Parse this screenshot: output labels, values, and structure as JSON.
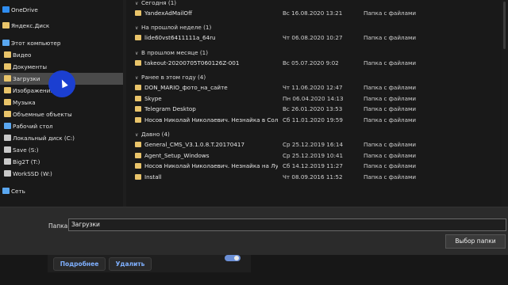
{
  "colors": {
    "folder_yellow": "#e9c46a",
    "onedrive_blue": "#2f8df0",
    "pc_blue": "#5aa7f0",
    "drive_gray": "#c9c9c9",
    "selected_bg": "#4a4a4a"
  },
  "sidebar": {
    "items": [
      {
        "label": "OneDrive",
        "icon": "onedrive-icon"
      },
      {
        "label": "Яндекс.Диск",
        "icon": "folder-icon"
      },
      {
        "label": "Этот компьютер",
        "icon": "computer-icon"
      },
      {
        "label": "Видео",
        "icon": "video-folder-icon"
      },
      {
        "label": "Документы",
        "icon": "documents-folder-icon"
      },
      {
        "label": "Загрузки",
        "icon": "downloads-folder-icon",
        "selected": true
      },
      {
        "label": "Изображения",
        "icon": "pictures-folder-icon"
      },
      {
        "label": "Музыка",
        "icon": "music-folder-icon"
      },
      {
        "label": "Объемные объекты",
        "icon": "3d-objects-folder-icon"
      },
      {
        "label": "Рабочий стол",
        "icon": "desktop-folder-icon"
      },
      {
        "label": "Локальный диск (C:)",
        "icon": "drive-icon"
      },
      {
        "label": "Save (S:)",
        "icon": "drive-icon"
      },
      {
        "label": "Big2T (T:)",
        "icon": "drive-icon"
      },
      {
        "label": "WorkSSD (W:)",
        "icon": "drive-icon"
      },
      {
        "label": "Сеть",
        "icon": "network-icon"
      }
    ]
  },
  "groups": [
    {
      "title": "Сегодня (1)",
      "rows": [
        {
          "name": "YandexAdMailOff",
          "date": "Вс 16.08.2020 13:21",
          "type": "Папка с файлами"
        }
      ]
    },
    {
      "title": "На прошлой неделе (1)",
      "rows": [
        {
          "name": "lide60vst6411111a_64ru",
          "date": "Чт 06.08.2020 10:27",
          "type": "Папка с файлами"
        }
      ]
    },
    {
      "title": "В прошлом месяце (1)",
      "rows": [
        {
          "name": "takeout-20200705T060126Z-001",
          "date": "Вс 05.07.2020 9:02",
          "type": "Папка с файлами"
        }
      ]
    },
    {
      "title": "Ранее в этом году (4)",
      "rows": [
        {
          "name": "DON_MARIO_фото_на_сайте",
          "date": "Чт 11.06.2020 12:47",
          "type": "Папка с файлами"
        },
        {
          "name": "Skype",
          "date": "Пн 06.04.2020 14:13",
          "type": "Папка с файлами"
        },
        {
          "name": "Telegram Desktop",
          "date": "Вс 26.01.2020 13:53",
          "type": "Папка с файлами"
        },
        {
          "name": "Носов Николай Николаевич. Незнайка в Сол...",
          "date": "Сб 11.01.2020 19:59",
          "type": "Папка с файлами"
        }
      ]
    },
    {
      "title": "Давно (4)",
      "rows": [
        {
          "name": "General_CMS_V3.1.0.8.T.20170417",
          "date": "Ср 25.12.2019 16:14",
          "type": "Папка с файлами"
        },
        {
          "name": "Agent_Setup_Windows",
          "date": "Ср 25.12.2019 10:41",
          "type": "Папка с файлами"
        },
        {
          "name": "Носов Николай Николаевич. Незнайка на Лу...",
          "date": "Сб 14.12.2019 11:27",
          "type": "Папка с файлами"
        },
        {
          "name": "Install",
          "date": "Чт 08.09.2016 11:52",
          "type": "Папка с файлами"
        }
      ]
    }
  ],
  "footer": {
    "folder_label": "Папка:",
    "folder_value": "Загрузки",
    "select_button": "Выбор папки"
  },
  "underlay": {
    "more_button": "Подробнее",
    "delete_button": "Удалить"
  }
}
